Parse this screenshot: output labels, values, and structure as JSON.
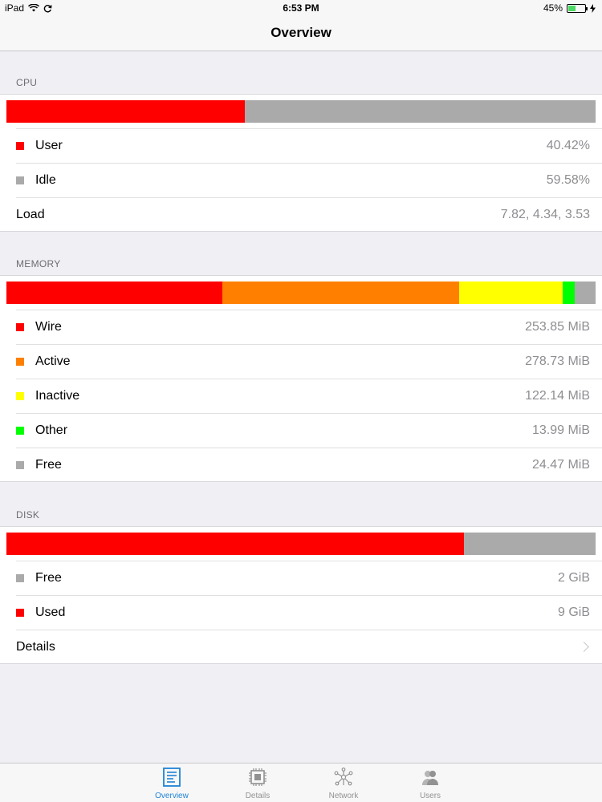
{
  "status_bar": {
    "device": "iPad",
    "time": "6:53 PM",
    "battery": "45%",
    "battery_level": 0.45
  },
  "nav": {
    "title": "Overview"
  },
  "colors": {
    "red": "#ff0000",
    "orange": "#ff8000",
    "yellow": "#ffff00",
    "green": "#00ff00",
    "gray": "#aaaaaa",
    "accent": "#1f82d6"
  },
  "cpu": {
    "header": "CPU",
    "bar": [
      {
        "name": "User",
        "fraction": 0.4042,
        "color": "#ff0000"
      },
      {
        "name": "Idle",
        "fraction": 0.5958,
        "color": "#aaaaaa"
      }
    ],
    "rows": [
      {
        "label": "User",
        "value": "40.42%",
        "color": "#ff0000"
      },
      {
        "label": "Idle",
        "value": "59.58%",
        "color": "#aaaaaa"
      }
    ],
    "load_label": "Load",
    "load_value": "7.82, 4.34, 3.53"
  },
  "memory": {
    "header": "MEMORY",
    "bar": [
      {
        "name": "Wire",
        "fraction": 0.3662,
        "color": "#ff0000"
      },
      {
        "name": "Active",
        "fraction": 0.4021,
        "color": "#ff8000"
      },
      {
        "name": "Inactive",
        "fraction": 0.1762,
        "color": "#ffff00"
      },
      {
        "name": "Other",
        "fraction": 0.0202,
        "color": "#00ff00"
      },
      {
        "name": "Free",
        "fraction": 0.0353,
        "color": "#aaaaaa"
      }
    ],
    "rows": [
      {
        "label": "Wire",
        "value": "253.85 MiB",
        "color": "#ff0000"
      },
      {
        "label": "Active",
        "value": "278.73 MiB",
        "color": "#ff8000"
      },
      {
        "label": "Inactive",
        "value": "122.14 MiB",
        "color": "#ffff00"
      },
      {
        "label": "Other",
        "value": "13.99 MiB",
        "color": "#00ff00"
      },
      {
        "label": "Free",
        "value": "24.47 MiB",
        "color": "#aaaaaa"
      }
    ]
  },
  "disk": {
    "header": "DISK",
    "bar": [
      {
        "name": "Used",
        "fraction": 0.776,
        "color": "#ff0000"
      },
      {
        "name": "Free",
        "fraction": 0.224,
        "color": "#aaaaaa"
      }
    ],
    "rows": [
      {
        "label": "Free",
        "value": "2 GiB",
        "color": "#aaaaaa"
      },
      {
        "label": "Used",
        "value": "9 GiB",
        "color": "#ff0000"
      }
    ],
    "details_label": "Details"
  },
  "tabs": [
    {
      "label": "Overview",
      "icon": "overview-icon",
      "active": true
    },
    {
      "label": "Details",
      "icon": "chip-icon",
      "active": false
    },
    {
      "label": "Network",
      "icon": "network-icon",
      "active": false
    },
    {
      "label": "Users",
      "icon": "users-icon",
      "active": false
    }
  ]
}
